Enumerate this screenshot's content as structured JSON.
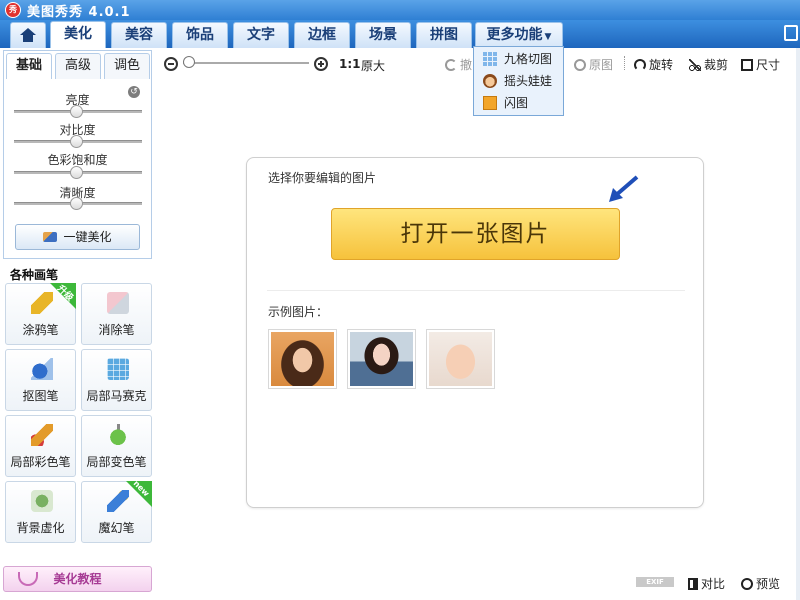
{
  "app": {
    "logo_text": "秀",
    "title": "美图秀秀 4.0.1"
  },
  "tabs": [
    {
      "label": "美化"
    },
    {
      "label": "美容"
    },
    {
      "label": "饰品"
    },
    {
      "label": "文字"
    },
    {
      "label": "边框"
    },
    {
      "label": "场景"
    },
    {
      "label": "拼图"
    }
  ],
  "more_tab": {
    "label": "更多功能",
    "caret": "▼"
  },
  "dropdown": {
    "items": [
      {
        "label": "九格切图",
        "icon": "grid-icon"
      },
      {
        "label": "摇头娃娃",
        "icon": "doll-icon"
      },
      {
        "label": "闪图",
        "icon": "flash-icon"
      }
    ]
  },
  "left_panel": {
    "sub_tabs": [
      "基础",
      "高级",
      "调色"
    ],
    "sliders": [
      {
        "label": "亮度",
        "value": 0.5
      },
      {
        "label": "对比度",
        "value": 0.5
      },
      {
        "label": "色彩饱和度",
        "value": 0.5
      },
      {
        "label": "清晰度",
        "value": 0.5
      }
    ],
    "onekey_label": "一键美化",
    "brush_heading": "各种画笔",
    "tools": [
      {
        "label": "涂鸦笔",
        "badge": "升级"
      },
      {
        "label": "消除笔",
        "badge": ""
      },
      {
        "label": "抠图笔",
        "badge": ""
      },
      {
        "label": "局部马赛克",
        "badge": ""
      },
      {
        "label": "局部彩色笔",
        "badge": ""
      },
      {
        "label": "局部变色笔",
        "badge": ""
      },
      {
        "label": "背景虚化",
        "badge": ""
      },
      {
        "label": "魔幻笔",
        "badge": "new"
      }
    ],
    "tutorial_label": "美化教程"
  },
  "toolbar": {
    "ratio": "1:1",
    "ratio_label": "原大",
    "undo_label": "撤",
    "original_label": "原图",
    "rotate_label": "旋转",
    "crop_label": "裁剪",
    "size_label": "尺寸"
  },
  "card": {
    "prompt": "选择你要编辑的图片",
    "open_label": "打开一张图片",
    "sample_label": "示例图片："
  },
  "bottom": {
    "exif": "EXIF",
    "compare_label": "对比",
    "preview_label": "预览"
  },
  "colors": {
    "tab_bar": "#2f7fd3",
    "open_button": "#f6c23c",
    "arrow": "#1f4fb8",
    "badge_green": "#3db83a"
  }
}
